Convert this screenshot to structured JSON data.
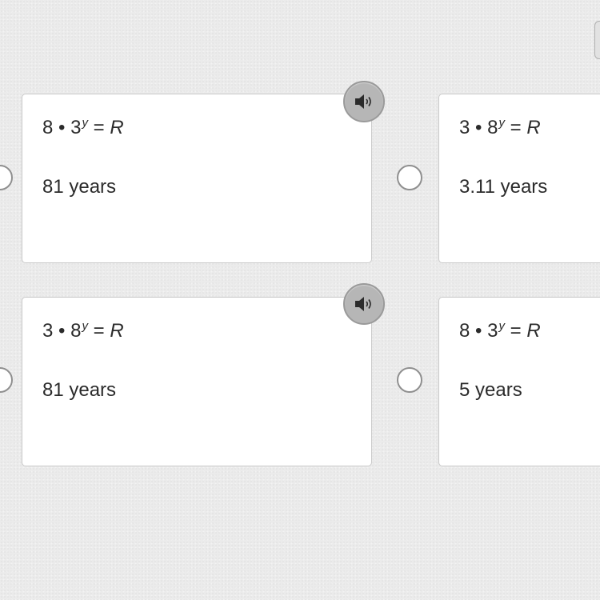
{
  "options": [
    {
      "equation": {
        "coef": "8",
        "op": " • ",
        "base": "3",
        "exponent": "y",
        "equals": " = ",
        "rhs": "R"
      },
      "answer": "81 years",
      "has_audio": true,
      "audio_icon": "speaker-icon",
      "selected": false
    },
    {
      "equation": {
        "coef": "3",
        "op": " • ",
        "base": "8",
        "exponent": "y",
        "equals": " = ",
        "rhs": "R"
      },
      "answer": "3.11 years",
      "has_audio": false,
      "selected": false
    },
    {
      "equation": {
        "coef": "3",
        "op": " • ",
        "base": "8",
        "exponent": "y",
        "equals": " = ",
        "rhs": "R"
      },
      "answer": "81 years",
      "has_audio": true,
      "audio_icon": "speaker-icon",
      "selected": false
    },
    {
      "equation": {
        "coef": "8",
        "op": " • ",
        "base": "3",
        "exponent": "y",
        "equals": " = ",
        "rhs": "R"
      },
      "answer": "5 years",
      "has_audio": false,
      "selected": false
    }
  ],
  "colors": {
    "background": "#ebebeb",
    "card": "#ffffff",
    "card_border": "#c9c9c9",
    "speaker_button": "#b6b6b6",
    "speaker_glyph": "#2b2b2b"
  }
}
